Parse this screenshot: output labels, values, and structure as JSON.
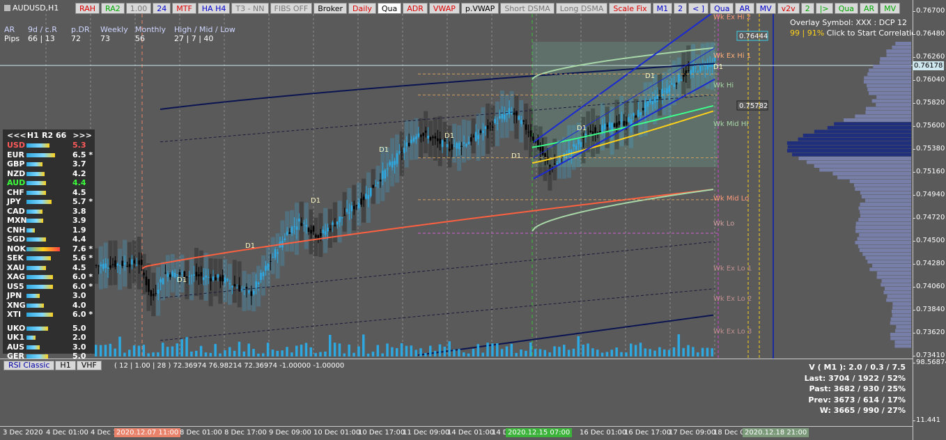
{
  "symbol": "AUDUSD,H1",
  "toolbar": [
    {
      "label": "RAH",
      "style": "red",
      "name": "rah-button"
    },
    {
      "label": "RA2",
      "style": "green",
      "name": "ra2-button"
    },
    {
      "label": "1.00",
      "style": "gray",
      "name": "factor-button"
    },
    {
      "label": "24",
      "style": "blue",
      "name": "hours-button"
    },
    {
      "label": "MTF",
      "style": "red",
      "name": "mtf-button"
    },
    {
      "label": "HA H4",
      "style": "blue",
      "name": "ha-h4-button"
    },
    {
      "label": "T3 - NN",
      "style": "gray",
      "name": "t3-button"
    },
    {
      "label": "FIBS OFF",
      "style": "gray",
      "name": "fibs-button"
    },
    {
      "label": "Broker",
      "style": "dark",
      "name": "broker-button"
    },
    {
      "label": "Daily",
      "style": "red",
      "name": "daily-button"
    },
    {
      "label": "Qua",
      "style": "white",
      "name": "qua-button"
    },
    {
      "label": "ADR",
      "style": "red",
      "name": "adr-button"
    },
    {
      "label": "VWAP",
      "style": "red",
      "name": "vwap-button"
    },
    {
      "label": "p.VWAP",
      "style": "dark",
      "name": "pvwap-button"
    },
    {
      "label": "Short DSMA",
      "style": "gray",
      "name": "short-dsma-button"
    },
    {
      "label": "Long DSMA",
      "style": "gray",
      "name": "long-dsma-button"
    },
    {
      "label": "Scale Fix",
      "style": "red",
      "name": "scale-fix-button"
    },
    {
      "label": "M1",
      "style": "blue",
      "name": "m1-button"
    },
    {
      "label": "2",
      "style": "blue",
      "name": "two-button"
    },
    {
      "label": "< ]",
      "style": "blue",
      "name": "back-button"
    },
    {
      "label": "Qua",
      "style": "blue",
      "name": "qua2-button"
    },
    {
      "label": "AR",
      "style": "blue",
      "name": "ar-button"
    },
    {
      "label": "MV",
      "style": "blue",
      "name": "mv-button"
    },
    {
      "label": "v2v",
      "style": "red",
      "name": "v2v-button"
    },
    {
      "label": "2",
      "style": "green",
      "name": "two2-button"
    },
    {
      "label": "|>",
      "style": "green",
      "name": "forward-button"
    },
    {
      "label": "Qua",
      "style": "green",
      "name": "qua3-button"
    },
    {
      "label": "AR",
      "style": "green",
      "name": "ar2-button"
    },
    {
      "label": "MV",
      "style": "green",
      "name": "mv2-button"
    }
  ],
  "pips_table": {
    "headers": [
      "AR",
      "9d / c.R",
      "p.DR",
      "Weekly",
      "Monthly",
      "High / Mid / Low"
    ],
    "values": [
      "Pips",
      "66 | 13",
      "72",
      "73",
      "56",
      "27  |  7  |  40"
    ]
  },
  "overlay": {
    "line1": "Overlay Symbol: XXX : DCP 12",
    "pct": "99 | 91%",
    "line2": " Click to Start Correlation"
  },
  "currency_panel": {
    "nav_prev": "<<<",
    "timeframe": "H1",
    "range": "R2 66",
    "nav_next": ">>>",
    "rows": [
      {
        "name": "USD",
        "value": "5.3",
        "mark": "",
        "bar": 0.55,
        "color": "#ff5a5a"
      },
      {
        "name": "EUR",
        "value": "6.5",
        "mark": "*",
        "bar": 0.68,
        "color": "#ffffff"
      },
      {
        "name": "GBP",
        "value": "3.7",
        "mark": "",
        "bar": 0.38,
        "color": "#ffffff"
      },
      {
        "name": "NZD",
        "value": "4.2",
        "mark": "",
        "bar": 0.44,
        "color": "#ffffff"
      },
      {
        "name": "AUD",
        "value": "4.4",
        "mark": "",
        "bar": 0.46,
        "color": "#3cff3c"
      },
      {
        "name": "CHF",
        "value": "4.5",
        "mark": "",
        "bar": 0.47,
        "color": "#ffffff"
      },
      {
        "name": "JPY",
        "value": "5.7",
        "mark": "*",
        "bar": 0.6,
        "color": "#ffffff"
      },
      {
        "name": "CAD",
        "value": "3.8",
        "mark": "",
        "bar": 0.39,
        "color": "#ffffff"
      },
      {
        "name": "MXN",
        "value": "3.9",
        "mark": "",
        "bar": 0.4,
        "color": "#ffffff"
      },
      {
        "name": "CNH",
        "value": "1.9",
        "mark": "",
        "bar": 0.2,
        "color": "#ffffff"
      },
      {
        "name": "SGD",
        "value": "4.4",
        "mark": "",
        "bar": 0.46,
        "color": "#ffffff"
      },
      {
        "name": "NOK",
        "value": "7.6",
        "mark": "*",
        "bar": 0.8,
        "color": "#ffffff"
      },
      {
        "name": "SEK",
        "value": "5.6",
        "mark": "*",
        "bar": 0.59,
        "color": "#ffffff"
      },
      {
        "name": "XAU",
        "value": "4.5",
        "mark": "",
        "bar": 0.47,
        "color": "#ffffff"
      },
      {
        "name": "XAG",
        "value": "6.0",
        "mark": "*",
        "bar": 0.63,
        "color": "#ffffff"
      },
      {
        "name": "US5",
        "value": "6.0",
        "mark": "*",
        "bar": 0.63,
        "color": "#ffffff"
      },
      {
        "name": "JPN",
        "value": "3.0",
        "mark": "",
        "bar": 0.31,
        "color": "#ffffff"
      },
      {
        "name": "XNG",
        "value": "4.0",
        "mark": "",
        "bar": 0.42,
        "color": "#ffffff"
      },
      {
        "name": "XTI",
        "value": "6.0",
        "mark": "*",
        "bar": 0.63,
        "color": "#ffffff"
      },
      {
        "name": "UKO",
        "value": "5.0",
        "mark": "",
        "bar": 0.52,
        "color": "#ffffff",
        "gap": true
      },
      {
        "name": "UK1",
        "value": "2.0",
        "mark": "",
        "bar": 0.21,
        "color": "#ffffff"
      },
      {
        "name": "AUS",
        "value": "3.0",
        "mark": "",
        "bar": 0.31,
        "color": "#ffffff"
      },
      {
        "name": "GER",
        "value": "5.0",
        "mark": "",
        "bar": 0.52,
        "color": "#ffffff"
      }
    ]
  },
  "price_axis": [
    "0.76700",
    "0.76480",
    "0.76260",
    "0.76040",
    "0.75820",
    "0.75600",
    "0.75380",
    "0.75160",
    "0.74940",
    "0.74720",
    "0.74500",
    "0.74280",
    "0.74060",
    "0.73840",
    "0.73620",
    "0.73410"
  ],
  "price_tags": {
    "current": "0.76178",
    "upper": "0.76444",
    "mid": "0.75782"
  },
  "level_labels": [
    "Wk Ex Hi 2",
    "Wk Ex Hi 1",
    "Wk Hi",
    "Wk Mid Hi",
    "Wk Mid Lo",
    "Wk Lo",
    "Wk Ex Lo 1",
    "Wk Ex Lo 2",
    "Wk Ex Lo 3"
  ],
  "d1_label": "D1",
  "time_axis": [
    "3 Dec 2020",
    "4 Dec 01:00",
    "4 Dec 1",
    "8 Dec 01:00",
    "8 Dec 17:00",
    "9 Dec 09:00",
    "10 Dec 01:00",
    "10 Dec 17:00",
    "11 Dec 09:00",
    "14 Dec 01:00",
    "14 D",
    "16 Dec 01:00",
    "16 Dec 17:00",
    "17 Dec 09:00",
    "18 Dec 01"
  ],
  "time_highlights": {
    "red": "2020.12.07 11:00",
    "green": "2020.12.15 07:00",
    "blue": "2020.12.18 21:00"
  },
  "sub_window": {
    "buttons": [
      "RSI Classic",
      "H1",
      "VHF"
    ],
    "params": "( 12 | 1.00 | 28 ) 72.36974 76.98214 72.36974 -1.00000 -1.00000",
    "axis_top": "98.56874",
    "axis_bottom": "11.441",
    "stats": [
      "V ( M1 ): 2.0 / 0.3 / 7.5",
      "Last: 3704 / 1922 / 52%",
      "Past: 3682 / 930 / 25%",
      "Prev: 3673 / 614 / 17%",
      "W: 3665 / 990 / 27%"
    ]
  },
  "colors": {
    "bg": "#5a5a5a",
    "candle_up": "#2ea8e0",
    "candle_dn": "#000000",
    "vwap": "#ff6040",
    "band_dark": "#0a1450"
  }
}
